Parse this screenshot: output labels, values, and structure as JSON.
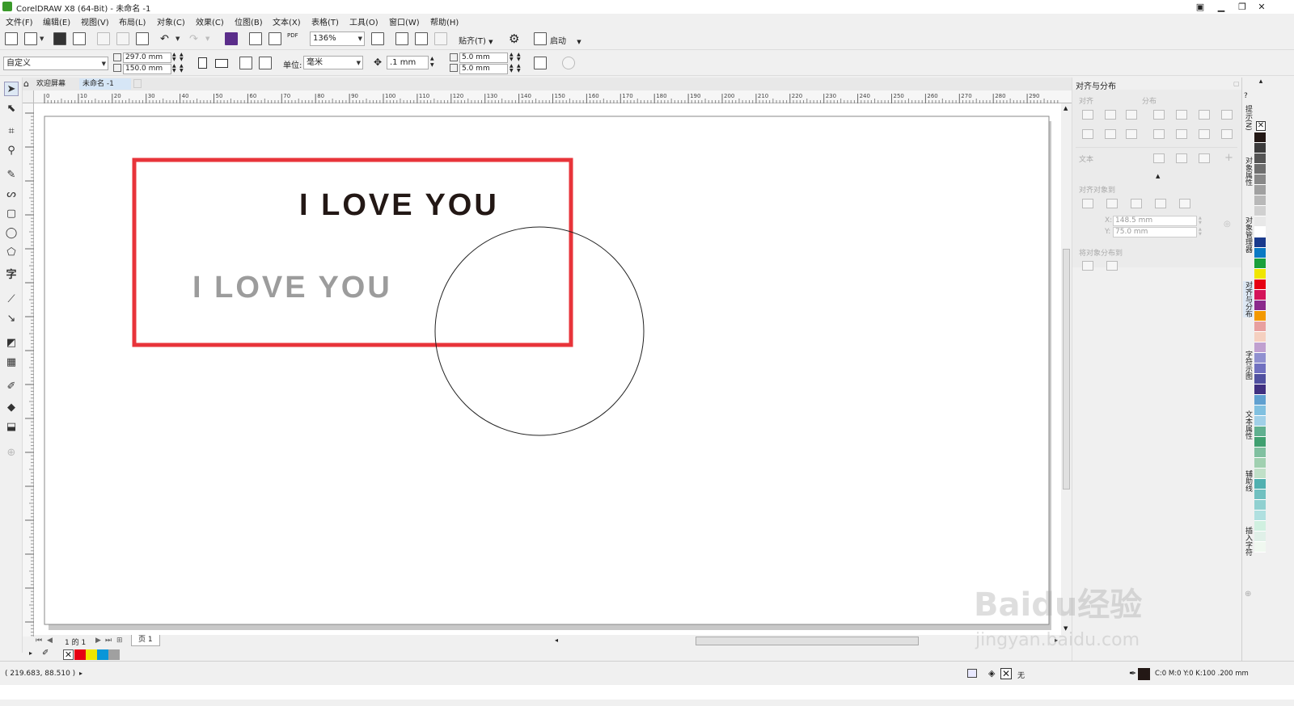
{
  "window": {
    "title": "CorelDRAW X8 (64-Bit) - 未命名 -1",
    "controls": [
      "minimize",
      "restore",
      "close"
    ]
  },
  "menu": [
    "文件(F)",
    "编辑(E)",
    "视图(V)",
    "布局(L)",
    "对象(C)",
    "效果(C)",
    "位图(B)",
    "文本(X)",
    "表格(T)",
    "工具(O)",
    "窗口(W)",
    "帮助(H)"
  ],
  "toolbar": {
    "zoom": "136%",
    "snap_label": "贴齐(T)",
    "launch_label": "启动",
    "pdf_label": "PDF"
  },
  "propbar": {
    "preset": "自定义",
    "width": "297.0 mm",
    "height": "150.0 mm",
    "units_label": "单位:",
    "units": "毫米",
    "nudge": ".1 mm",
    "dup_x": "5.0 mm",
    "dup_y": "5.0 mm"
  },
  "doc_tabs": [
    "欢迎屏幕",
    "未命名 -1"
  ],
  "ruler": {
    "h_labels": [
      "0",
      "10",
      "20",
      "30",
      "40",
      "50",
      "60",
      "70",
      "80",
      "90",
      "100",
      "110",
      "120",
      "130",
      "140",
      "150",
      "160",
      "170",
      "180",
      "190",
      "200",
      "210",
      "220",
      "230",
      "240",
      "250",
      "260",
      "270",
      "280",
      "290"
    ]
  },
  "canvas": {
    "text_dark": "I LOVE YOU",
    "text_gray": "I LOVE YOU",
    "rect_color": "#e8343a",
    "dark_text_color": "#231815",
    "gray_text_color": "#9c9c9c"
  },
  "page_nav": {
    "page_counter": "1 的 1",
    "page_tab": "页 1"
  },
  "docker": {
    "title": "对齐与分布",
    "align_label": "对齐",
    "distribute_label": "分布",
    "text_label": "文本",
    "align_objects_to": "对齐对象到",
    "x_value": "148.5 mm",
    "y_value": "75.0 mm",
    "x_label": "X:",
    "y_label": "Y:",
    "distribute_to": "将对象分布到"
  },
  "side_tabs": [
    "提示(N)",
    "对象属性",
    "对象管理器",
    "对齐与分布",
    "字符示图",
    "文本属性",
    "辅助线",
    "插入字符"
  ],
  "palette": [
    "#231815",
    "#3c3c3c",
    "#555555",
    "#6e6e6e",
    "#888888",
    "#a0a0a0",
    "#b8b8b8",
    "#d0d0d0",
    "#e8e8e8",
    "#ffffff",
    "#1a3a8c",
    "#0a7ac4",
    "#1aa03c",
    "#f0e600",
    "#e60012",
    "#d4145a",
    "#8b2a8c",
    "#f39800",
    "#e8a0a0",
    "#f5d0c0",
    "#c0a0d0",
    "#9090d0",
    "#7070c0",
    "#5050a0",
    "#403080",
    "#60a0d0",
    "#80c0e0",
    "#a0d0e8",
    "#60b090",
    "#40a070",
    "#80c0a0",
    "#a0d0b0",
    "#c0e0c8",
    "#50b0b0",
    "#70c0c0",
    "#90d0d0",
    "#b0e0e0",
    "#d0f0e0",
    "#e0f0e8",
    "#f0f8f0"
  ],
  "doc_palette": [
    "#e60012",
    "#f0e600",
    "#0a96d8",
    "#a0a0a0"
  ],
  "status": {
    "coords": "( 219.683, 88.510 )",
    "fill_label": "无",
    "outline_info": "C:0 M:0 Y:0 K:100 .200 mm"
  },
  "watermark": {
    "brand": "Baidu经验",
    "url": "jingyan.baidu.com"
  }
}
